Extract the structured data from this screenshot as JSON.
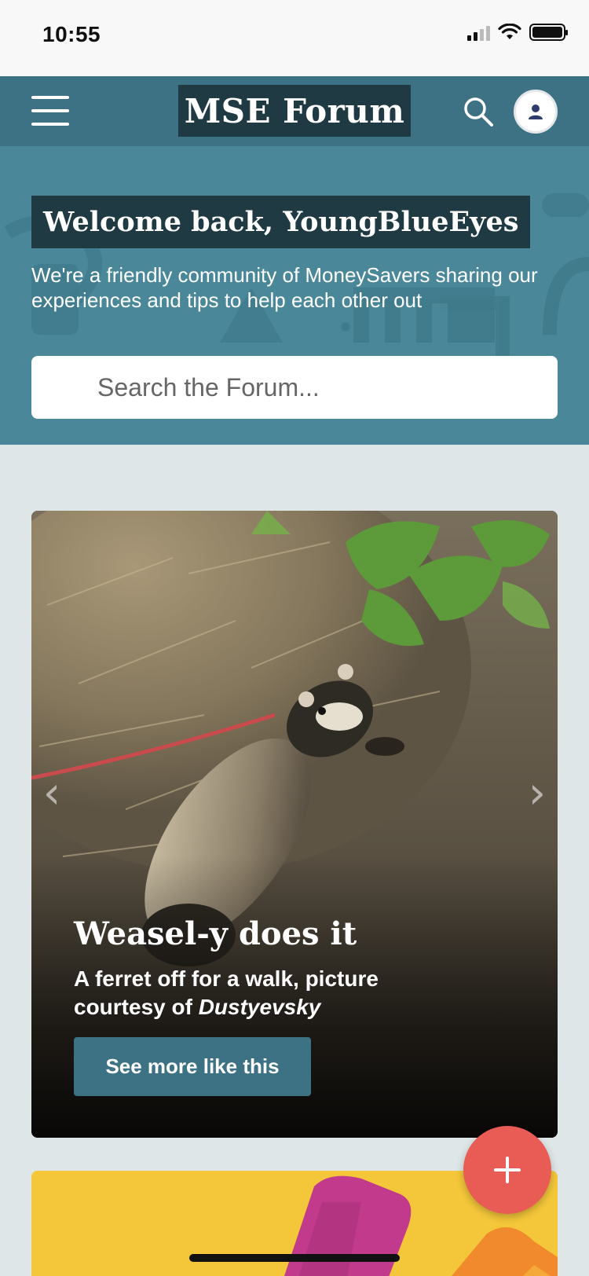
{
  "status_bar": {
    "time": "10:55"
  },
  "header": {
    "logo_text": "MSE Forum",
    "menu_icon": "hamburger-menu-icon",
    "search_icon": "search-icon",
    "avatar_icon": "user-avatar-icon"
  },
  "hero": {
    "welcome": "Welcome back, YoungBlueEyes",
    "subtitle": "We're a friendly community of MoneySavers sharing our experiences and tips to help each other out",
    "search_placeholder": "Search the Forum..."
  },
  "feature": {
    "title": "Weasel-y does it",
    "description_prefix": "A ferret off for a walk, picture courtesy of ",
    "description_author": "Dustyevsky",
    "button_label": "See more like this",
    "prev_icon": "chevron-left-icon",
    "next_icon": "chevron-right-icon"
  },
  "fab": {
    "icon": "plus-icon"
  },
  "colors": {
    "header_bg": "#3d7285",
    "hero_bg": "#4a8899",
    "dark_box": "#1f3a43",
    "fab": "#e85c55",
    "page_bg": "#dfe6e7"
  }
}
